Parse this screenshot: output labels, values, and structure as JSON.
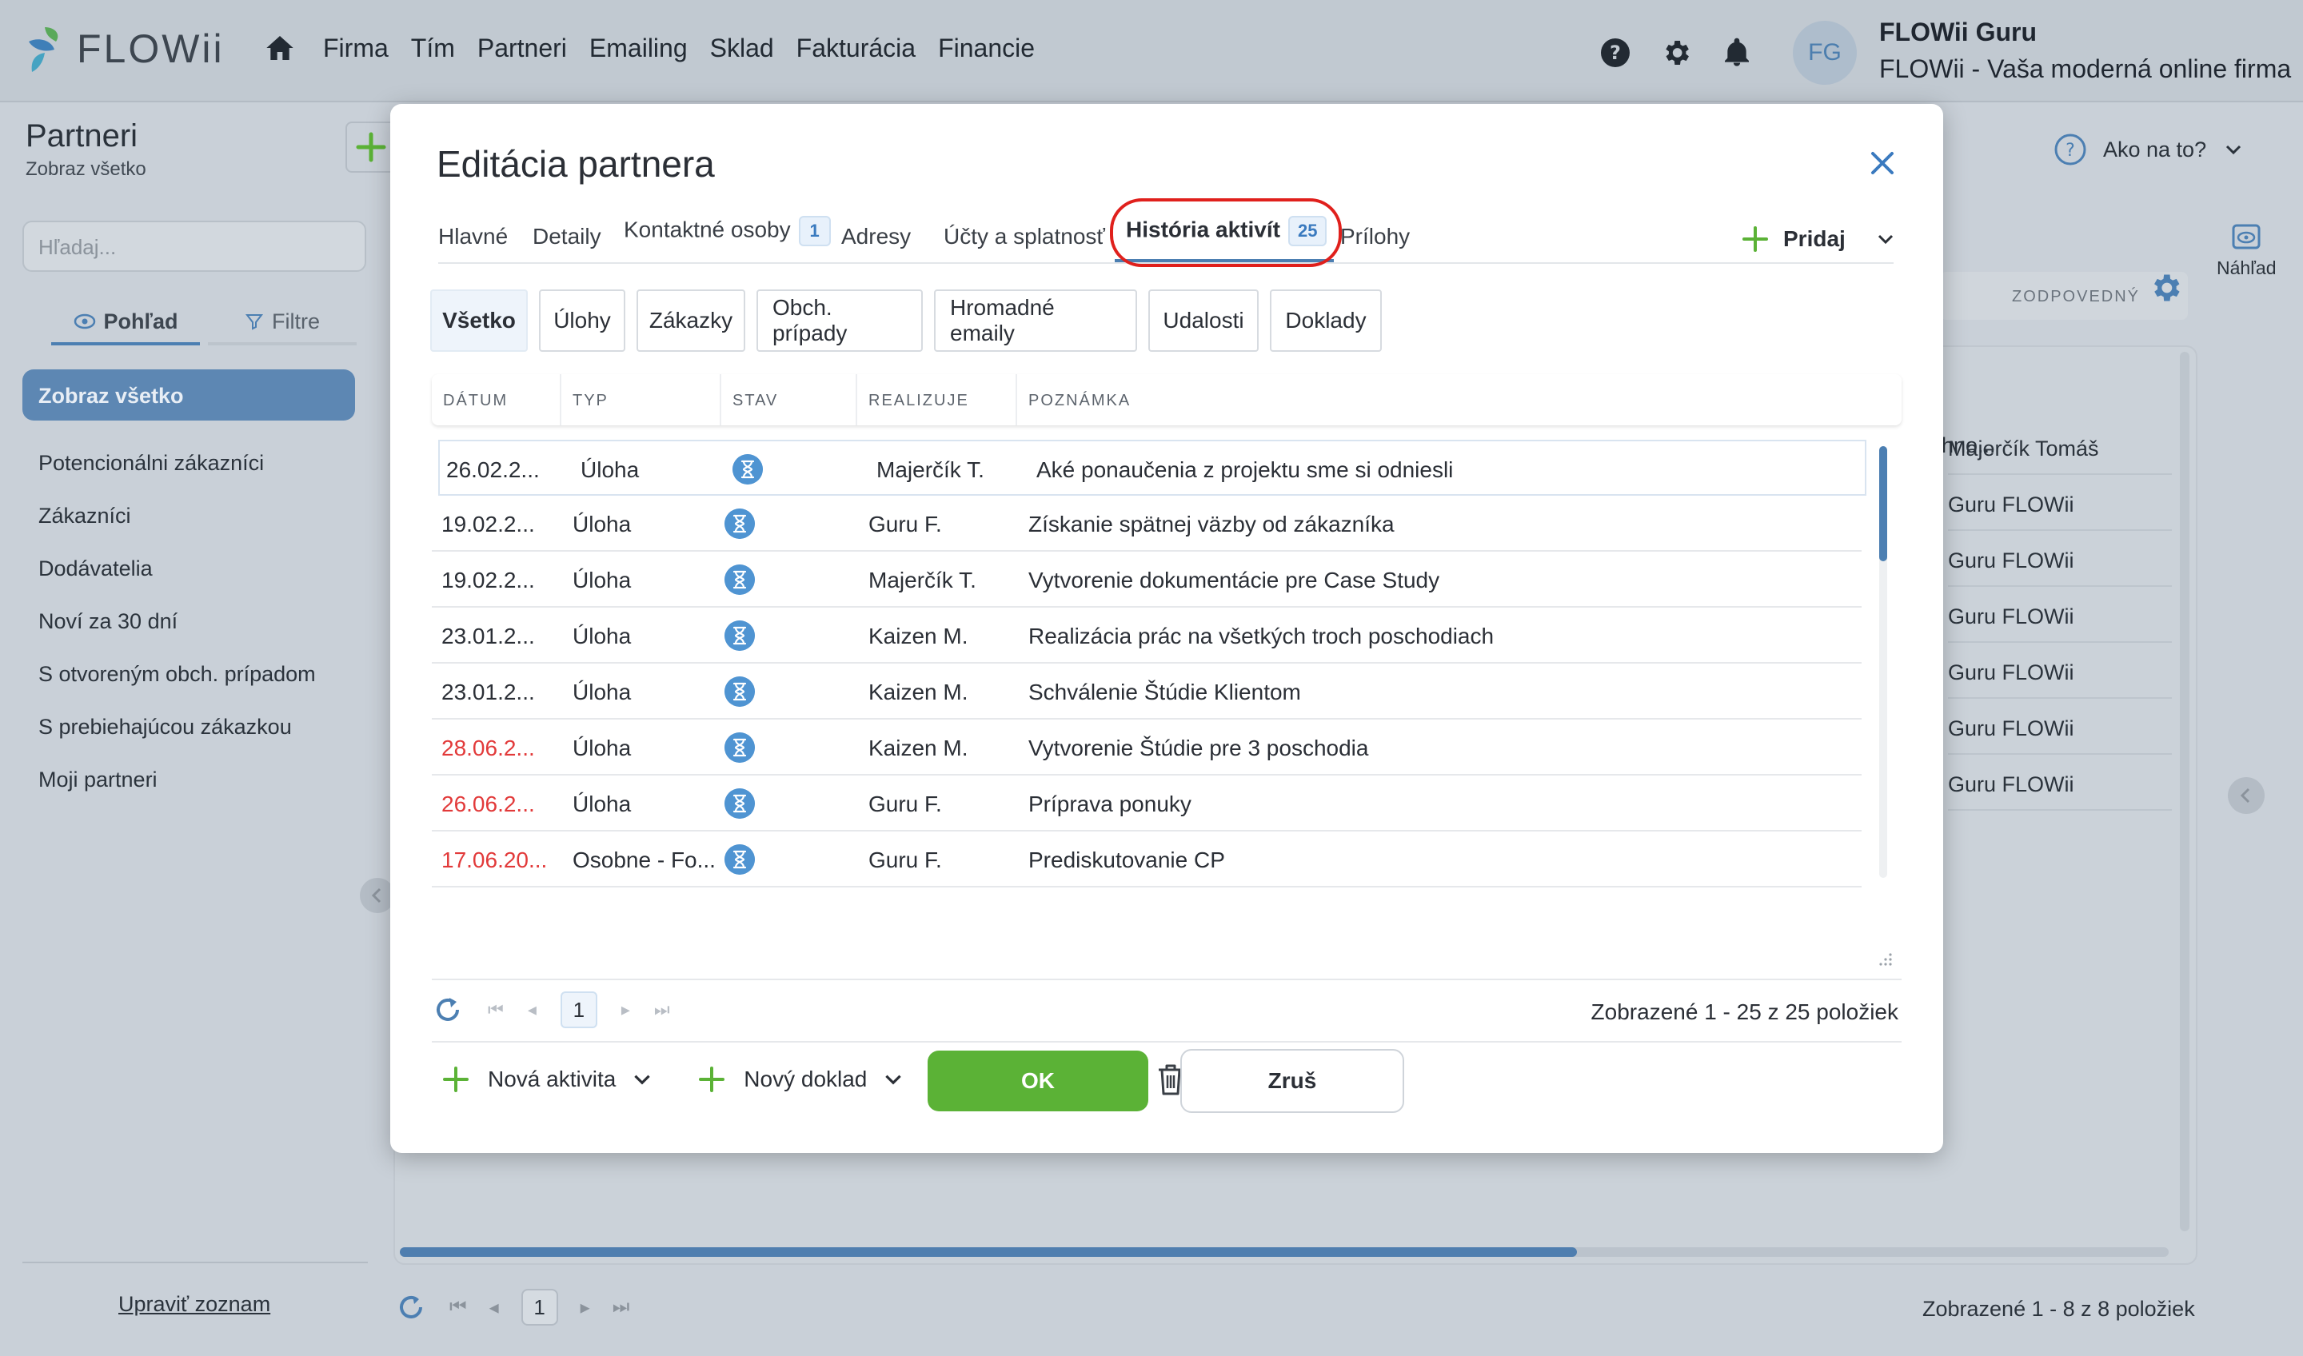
{
  "brand": {
    "name": "FLOWii"
  },
  "nav": {
    "items": [
      "Firma",
      "Tím",
      "Partneri",
      "Emailing",
      "Sklad",
      "Fakturácia",
      "Financie"
    ]
  },
  "user": {
    "initials": "FG",
    "name": "FLOWii Guru",
    "company": "FLOWii - Vaša moderná online firma"
  },
  "sidebar": {
    "title": "Partneri",
    "subtitle": "Zobraz všetko",
    "search_placeholder": "Hľadaj...",
    "tabs": [
      "Pohľad",
      "Filtre"
    ],
    "active_item": "Zobraz všetko",
    "items": [
      "Potencionálni zákazníci",
      "Zákazníci",
      "Dodávatelia",
      "Noví za 30 dní",
      "S otvoreným obch. prípadom",
      "S prebiehajúcou zákazkou",
      "Moji partneri"
    ],
    "edit_list": "Upraviť zoznam"
  },
  "background": {
    "help": "Ako na to?",
    "preview": "Náhľad",
    "responsible_header": "ZODPOVEDNÝ",
    "partial_column_text": "hno...",
    "responsible_rows": [
      "Majerčík Tomáš",
      "Guru FLOWii",
      "Guru FLOWii",
      "Guru FLOWii",
      "Guru FLOWii",
      "Guru FLOWii",
      "Guru FLOWii"
    ],
    "page": "1",
    "count": "Zobrazené 1 - 8 z 8 položiek"
  },
  "modal": {
    "title": "Editácia partnera",
    "tabs": [
      {
        "label": "Hlavné"
      },
      {
        "label": "Detaily"
      },
      {
        "label": "Kontaktné osoby",
        "badge": "1"
      },
      {
        "label": "Adresy"
      },
      {
        "label": "Účty a splatnosť"
      },
      {
        "label": "História aktivít",
        "badge": "25"
      },
      {
        "label": "Prílohy"
      }
    ],
    "add_label": "Pridaj",
    "filters": [
      "Všetko",
      "Úlohy",
      "Zákazky",
      "Obch. prípady",
      "Hromadné emaily",
      "Udalosti",
      "Doklady"
    ],
    "columns": [
      "DÁTUM",
      "TYP",
      "STAV",
      "REALIZUJE",
      "POZNÁMKA"
    ],
    "rows": [
      {
        "date": "26.02.2...",
        "type": "Úloha",
        "who": "Majerčík T.",
        "note": "Aké ponaučenia z projektu sme si odniesli",
        "overdue": false
      },
      {
        "date": "19.02.2...",
        "type": "Úloha",
        "who": "Guru F.",
        "note": "Získanie spätnej väzby od zákazníka",
        "overdue": false
      },
      {
        "date": "19.02.2...",
        "type": "Úloha",
        "who": "Majerčík T.",
        "note": "Vytvorenie dokumentácie pre Case Study",
        "overdue": false
      },
      {
        "date": "23.01.2...",
        "type": "Úloha",
        "who": "Kaizen M.",
        "note": "Realizácia prác na všetkých troch poschodiach",
        "overdue": false
      },
      {
        "date": "23.01.2...",
        "type": "Úloha",
        "who": "Kaizen M.",
        "note": "Schválenie Štúdie Klientom",
        "overdue": false
      },
      {
        "date": "28.06.2...",
        "type": "Úloha",
        "who": "Kaizen M.",
        "note": "Vytvorenie Štúdie pre 3 poschodia",
        "overdue": true
      },
      {
        "date": "26.06.2...",
        "type": "Úloha",
        "who": "Guru F.",
        "note": "Príprava ponuky",
        "overdue": true
      },
      {
        "date": "17.06.20...",
        "type": "Osobne - Fo...",
        "who": "Guru F.",
        "note": "Prediskutovanie CP",
        "overdue": true
      }
    ],
    "pager": {
      "page": "1",
      "count": "Zobrazené 1 - 25 z 25 položiek"
    },
    "actions": {
      "new_activity": "Nová aktivita",
      "new_document": "Nový doklad"
    },
    "ok": "OK",
    "cancel": "Zruš"
  },
  "colors": {
    "accent": "#4c7fb2",
    "ok_green": "#5bb236",
    "overdue_red": "#e23a3a",
    "highlight_red": "#e0201c"
  }
}
